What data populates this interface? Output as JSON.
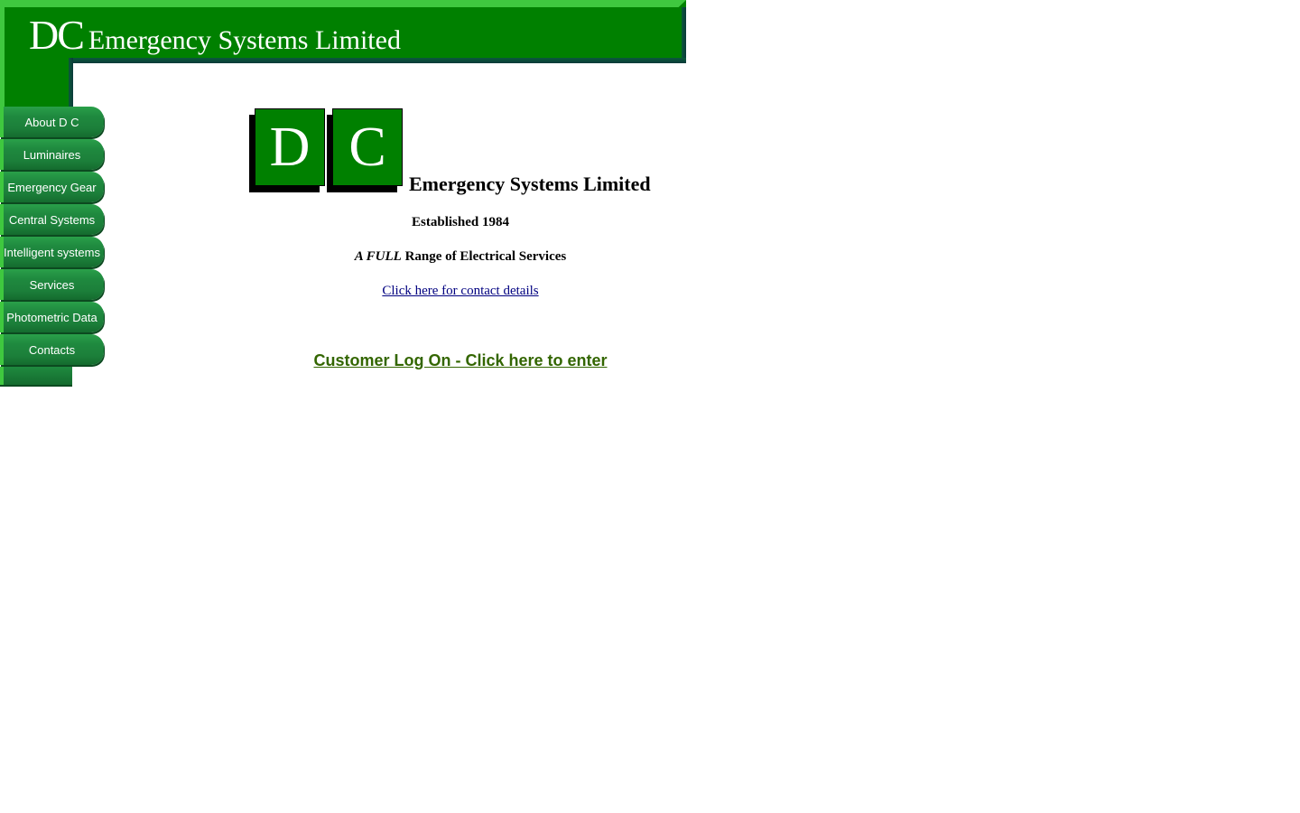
{
  "banner": {
    "logo_initials": "DC",
    "company_name": "Emergency Systems Limited"
  },
  "nav": {
    "items": [
      {
        "label": "About D C"
      },
      {
        "label": "Luminaires"
      },
      {
        "label": "Emergency Gear"
      },
      {
        "label": "Central Systems"
      },
      {
        "label": "Intelligent systems"
      },
      {
        "label": "Services"
      },
      {
        "label": "Photometric Data"
      },
      {
        "label": "Contacts"
      }
    ]
  },
  "main": {
    "logo_letter_1": "D",
    "logo_letter_2": "C",
    "company_name": "Emergency Systems Limited",
    "established": "Established 1984",
    "tagline_emphasis": "A FULL",
    "tagline_rest": " Range of Electrical Services",
    "contact_link": "Click here for contact details",
    "login_link": "Customer Log On - Click here to enter"
  },
  "colors": {
    "brand_green": "#008000",
    "highlight_green": "#3fc83f",
    "login_link": "#336600",
    "contact_link": "#000080"
  }
}
